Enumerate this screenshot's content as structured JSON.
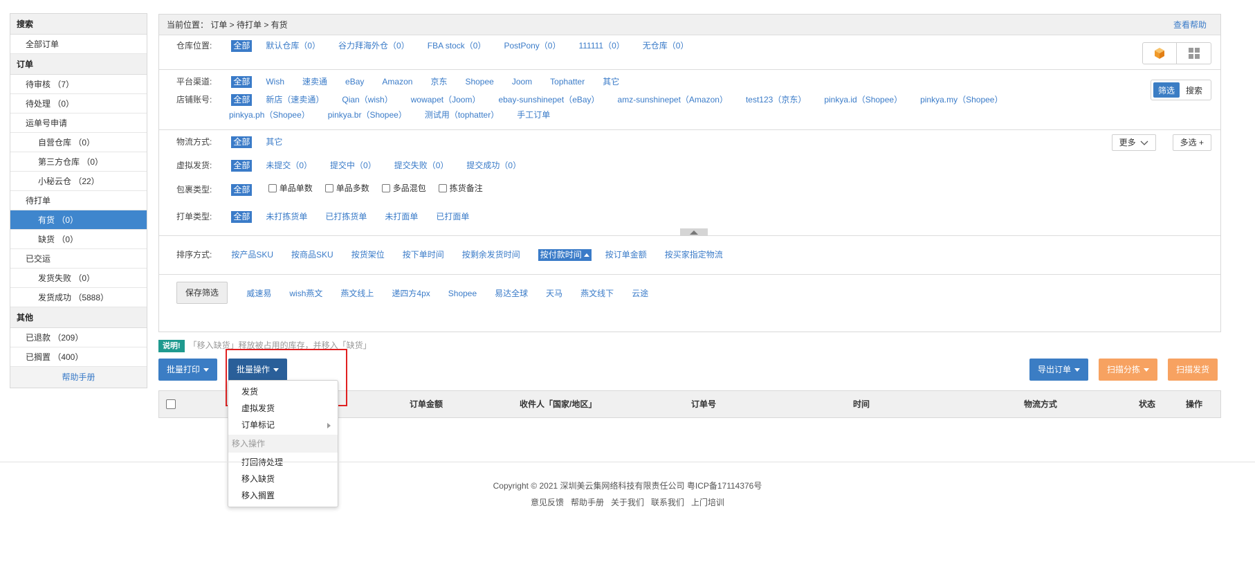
{
  "sidebar": {
    "sections": [
      {
        "title": "搜索",
        "items": [
          {
            "label": "全部订单",
            "sub": false,
            "active": false
          }
        ]
      },
      {
        "title": "订单",
        "items": [
          {
            "label": "待审核 （7）",
            "sub": false,
            "active": false
          },
          {
            "label": "待处理 （0）",
            "sub": false,
            "active": false
          },
          {
            "label": "运单号申请",
            "sub": false,
            "active": false
          },
          {
            "label": "自营仓库 （0）",
            "sub": true,
            "active": false
          },
          {
            "label": "第三方仓库 （0）",
            "sub": true,
            "active": false
          },
          {
            "label": "小秘云仓 （22）",
            "sub": true,
            "active": false
          },
          {
            "label": "待打单",
            "sub": false,
            "active": false
          },
          {
            "label": "有货 （0）",
            "sub": true,
            "active": true
          },
          {
            "label": "缺货 （0）",
            "sub": true,
            "active": false
          },
          {
            "label": "已交运",
            "sub": false,
            "active": false
          },
          {
            "label": "发货失败 （0）",
            "sub": true,
            "active": false
          },
          {
            "label": "发货成功 （5888）",
            "sub": true,
            "active": false
          }
        ]
      },
      {
        "title": "其他",
        "items": [
          {
            "label": "已退款 （209）",
            "sub": false,
            "active": false
          },
          {
            "label": "已搁置 （400）",
            "sub": false,
            "active": false
          }
        ]
      }
    ],
    "help": "帮助手册"
  },
  "breadcrumb": {
    "text": "当前位置： 订单 > 待打单 > 有货",
    "help": "查看帮助"
  },
  "filters": {
    "warehouse": {
      "label": "仓库位置:",
      "options": [
        "全部",
        "默认仓库（0）",
        "谷力拜海外仓（0）",
        "FBA stock（0）",
        "PostPony（0）",
        "111111（0）",
        "无仓库（0）"
      ]
    },
    "platform": {
      "label": "平台渠道:",
      "options": [
        "全部",
        "Wish",
        "速卖通",
        "eBay",
        "Amazon",
        "京东",
        "Shopee",
        "Joom",
        "Tophatter",
        "其它"
      ]
    },
    "store": {
      "label": "店铺账号:",
      "options": [
        "全部",
        "新店（速卖通）",
        "Qian（wish）",
        "wowapet（Joom）",
        "ebay-sunshinepet（eBay）",
        "amz-sunshinepet（Amazon）",
        "test123（京东）",
        "pinkya.id（Shopee）",
        "pinkya.my（Shopee）"
      ],
      "options2": [
        "pinkya.ph（Shopee）",
        "pinkya.br（Shopee）",
        "测试用（tophatter）",
        "手工订单"
      ]
    },
    "logistics": {
      "label": "物流方式:",
      "options": [
        "全部",
        "其它"
      ]
    },
    "virtual": {
      "label": "虚拟发货:",
      "options": [
        "全部",
        "未提交（0）",
        "提交中（0）",
        "提交失败（0）",
        "提交成功（0）"
      ]
    },
    "package": {
      "label": "包裹类型:",
      "all": "全部",
      "checks": [
        "单品单数",
        "单品多数",
        "多品混包",
        "拣货备注"
      ]
    },
    "printtype": {
      "label": "打单类型:",
      "options": [
        "全部",
        "未打拣货单",
        "已打拣货单",
        "未打面单",
        "已打面单"
      ]
    },
    "sort": {
      "label": "排序方式:",
      "options": [
        "按产品SKU",
        "按商品SKU",
        "按货架位",
        "按下单时间",
        "按剩余发货时间",
        "按付款时间",
        "按订单金额",
        "按买家指定物流"
      ],
      "selected": "按付款时间"
    },
    "saved": {
      "button": "保存筛选",
      "options": [
        "威速易",
        "wish燕文",
        "燕文线上",
        "递四方4px",
        "Shopee",
        "易达全球",
        "天马",
        "燕文线下",
        "云途"
      ]
    }
  },
  "controls": {
    "filter": "筛选",
    "search": "搜索",
    "more": "更多",
    "multi": "多选 +"
  },
  "note": {
    "tag": "说明!",
    "text": "「移入缺货」释放被占用的库存，并移入「缺货」"
  },
  "actions": {
    "batch_print": "批量打印",
    "batch_ops": "批量操作",
    "export": "导出订单",
    "scan_sort": "扫描分拣",
    "scan_ship": "扫描发货"
  },
  "table": {
    "headers": [
      "订单金额",
      "收件人「国家/地区」",
      "订单号",
      "时间",
      "物流方式",
      "状态",
      "操作"
    ]
  },
  "dropdown": {
    "items": [
      "发货",
      "虚拟发货",
      "订单标记"
    ],
    "group": "移入操作",
    "group_items": [
      "打回待处理",
      "移入缺货",
      "移入搁置"
    ]
  },
  "footer": {
    "copyright": "Copyright ©  2021 深圳美云集网络科技有限责任公司  粤ICP备17114376号",
    "links": [
      "意见反馈",
      "帮助手册",
      "关于我们",
      "联系我们",
      "上门培训"
    ]
  },
  "icons": {
    "box": "box-icon",
    "grid": "grid-icon",
    "caret": "caret-down-icon",
    "chevron": "chevron-down-icon",
    "arrow": "caret-right-icon",
    "collapse": "caret-up-icon"
  },
  "colors": {
    "accent": "#3a7bc8",
    "active": "#3f86cd",
    "orange": "#f7a261",
    "red": "#e02020",
    "teal": "#1f9a8f"
  }
}
